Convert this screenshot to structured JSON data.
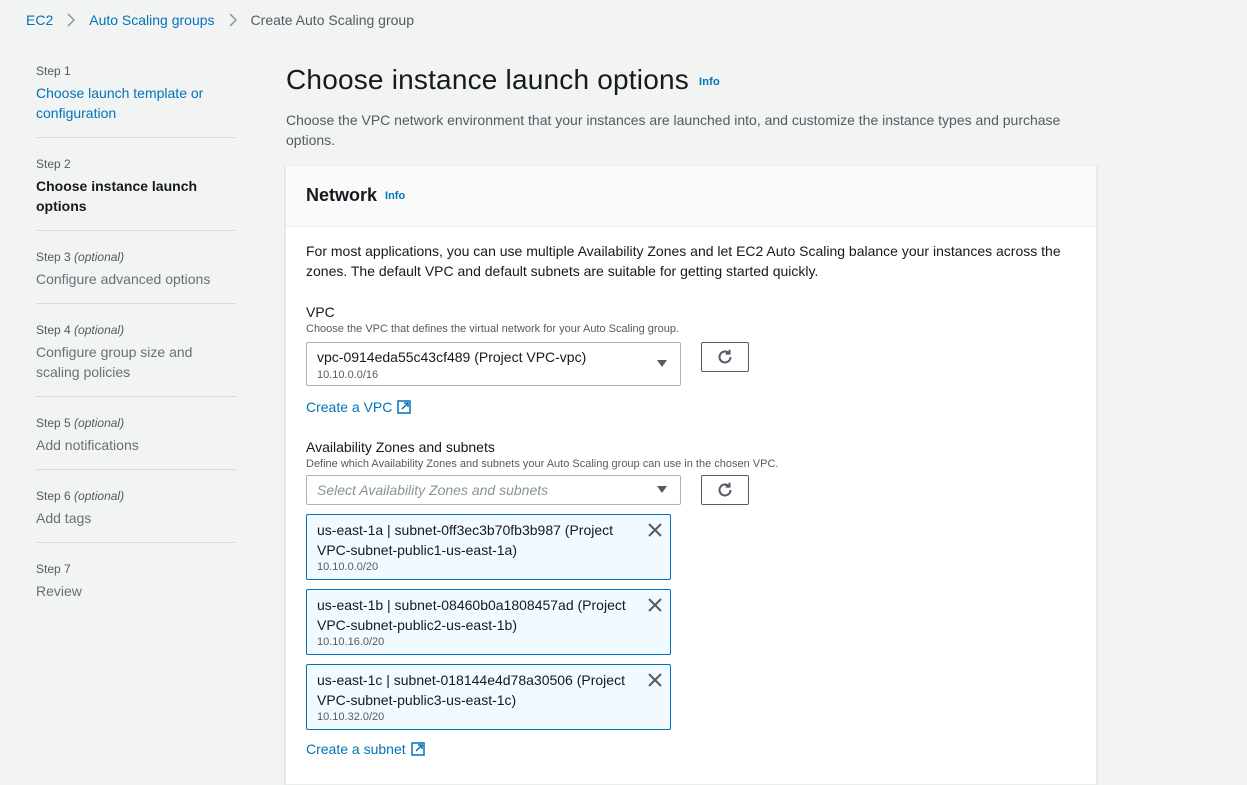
{
  "breadcrumb": {
    "items": [
      "EC2",
      "Auto Scaling groups",
      "Create Auto Scaling group"
    ]
  },
  "steps": [
    {
      "label": "Step 1",
      "optional": "",
      "title": "Choose launch template or configuration"
    },
    {
      "label": "Step 2",
      "optional": "",
      "title": "Choose instance launch options"
    },
    {
      "label": "Step 3",
      "optional": "(optional)",
      "title": "Configure advanced options"
    },
    {
      "label": "Step 4",
      "optional": "(optional)",
      "title": "Configure group size and scaling policies"
    },
    {
      "label": "Step 5",
      "optional": "(optional)",
      "title": "Add notifications"
    },
    {
      "label": "Step 6",
      "optional": "(optional)",
      "title": "Add tags"
    },
    {
      "label": "Step 7",
      "optional": "",
      "title": "Review"
    }
  ],
  "main": {
    "title": "Choose instance launch options",
    "info": "Info",
    "description": "Choose the VPC network environment that your instances are launched into, and customize the instance types and purchase options."
  },
  "network": {
    "title": "Network",
    "info": "Info",
    "description": "For most applications, you can use multiple Availability Zones and let EC2 Auto Scaling balance your instances across the zones. The default VPC and default subnets are suitable for getting started quickly.",
    "vpc": {
      "label": "VPC",
      "description": "Choose the VPC that defines the virtual network for your Auto Scaling group.",
      "selected": "vpc-0914eda55c43cf489 (Project VPC-vpc)",
      "cidr": "10.10.0.0/16",
      "create_link": "Create a VPC"
    },
    "azs": {
      "label": "Availability Zones and subnets",
      "description": "Define which Availability Zones and subnets your Auto Scaling group can use in the chosen VPC.",
      "placeholder": "Select Availability Zones and subnets",
      "tokens": [
        {
          "line1": "us-east-1a | subnet-0ff3ec3b70fb3b987 (Project",
          "line2": "VPC-subnet-public1-us-east-1a)",
          "cidr": "10.10.0.0/20"
        },
        {
          "line1": "us-east-1b | subnet-08460b0a1808457ad (Project",
          "line2": "VPC-subnet-public2-us-east-1b)",
          "cidr": "10.10.16.0/20"
        },
        {
          "line1": "us-east-1c | subnet-018144e4d78a30506 (Project",
          "line2": "VPC-subnet-public3-us-east-1c)",
          "cidr": "10.10.32.0/20"
        }
      ],
      "create_link": "Create a subnet"
    }
  },
  "icons": {
    "breadcrumb_separator": "chevron-right-icon",
    "dropdown": "caret-down-icon",
    "refresh": "refresh-icon",
    "external": "external-link-icon",
    "remove": "close-icon"
  },
  "colors": {
    "link": "#0073bb",
    "token_bg": "#f1faff",
    "page_bg": "#f2f3f3"
  }
}
